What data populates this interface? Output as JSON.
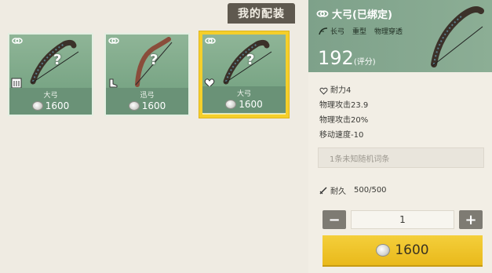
{
  "loadout_tab": "我的配装",
  "items": [
    {
      "name": "大弓",
      "price": "1600",
      "slot_icon": "tower-icon",
      "bow_icon": "dark-bow-icon"
    },
    {
      "name": "迅弓",
      "price": "1600",
      "slot_icon": "boot-icon",
      "bow_icon": "red-bow-icon"
    },
    {
      "name": "大弓",
      "price": "1600",
      "slot_icon": "heart-icon",
      "bow_icon": "dark-bow-icon",
      "selected": true
    }
  ],
  "detail": {
    "title": "大弓(已绑定)",
    "tags": [
      "长弓",
      "重型",
      "物理穿透"
    ],
    "score": "192",
    "score_label": "(评分)",
    "stats": [
      "耐力4",
      "物理攻击23.9",
      "物理攻击20%",
      "移动速度-10"
    ],
    "random_affix": "1条未知随机词条",
    "durability_label": "耐久",
    "durability_value": "500/500",
    "quantity": "1",
    "minus_label": "−",
    "plus_label": "+",
    "buy_price": "1600"
  },
  "colors": {
    "card_green": "#79a585",
    "selected_border": "#f5cf2a",
    "buy_button": "#f0c82f"
  }
}
